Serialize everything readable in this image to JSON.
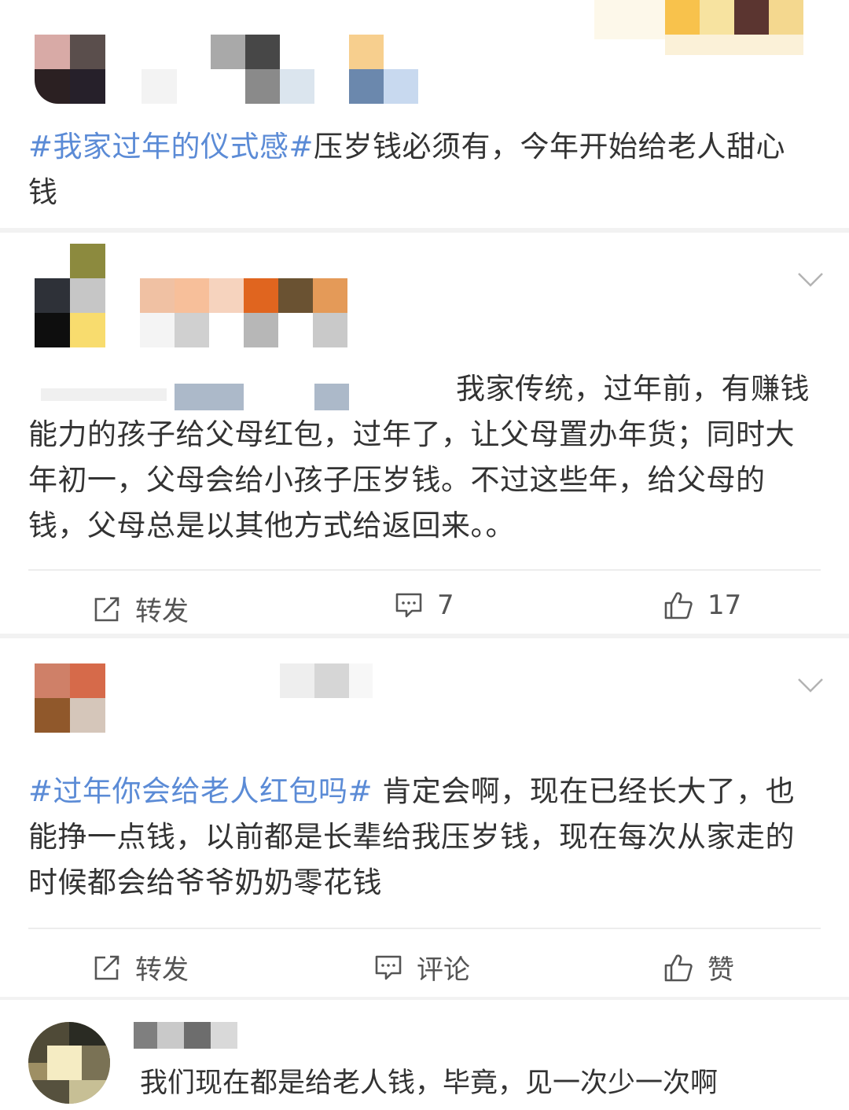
{
  "colors": {
    "tag": "#5b8bd6",
    "text": "#333333",
    "action": "#555555",
    "divider": "#ededed",
    "section_bg": "#f2f2f2"
  },
  "post1": {
    "tag": "#我家过年的仪式感#",
    "text": "压岁钱必须有，今年开始给老人甜心钱"
  },
  "post2": {
    "text": "我家传统，过年前，有赚钱能力的孩子给父母红包，过年了，让父母置办年货；同时大年初一，父母会给小孩子压岁钱。不过这些年，给父母的钱，父母总是以其他方式给返回来。。",
    "actions": {
      "repost_label": "转发",
      "comment_count": "7",
      "like_count": "17"
    }
  },
  "post3": {
    "tag": "#过年你会给老人红包吗#",
    "text": " 肯定会啊，现在已经长大了，也能挣一点钱，以前都是长辈给我压岁钱，现在每次从家走的时候都会给爷爷奶奶零花钱",
    "actions": {
      "repost_label": "转发",
      "comment_label": "评论",
      "like_label": "赞"
    }
  },
  "comment1": {
    "text": "我们现在都是给老人钱，毕竟，见一次少一次啊"
  }
}
